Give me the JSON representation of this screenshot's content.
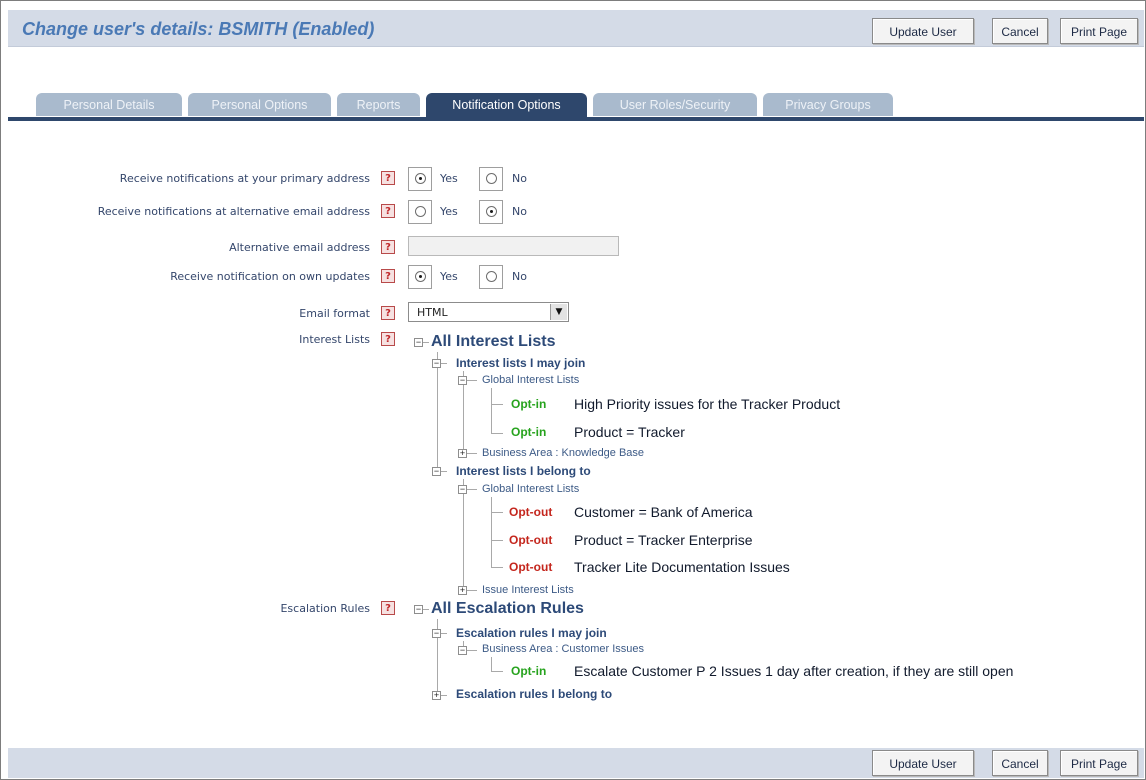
{
  "header": {
    "title": "Change user's details: BSMITH (Enabled)",
    "buttons": {
      "update": "Update User",
      "cancel": "Cancel",
      "print": "Print Page"
    }
  },
  "tabs": [
    {
      "label": "Personal Details",
      "active": false
    },
    {
      "label": "Personal Options",
      "active": false
    },
    {
      "label": "Reports",
      "active": false
    },
    {
      "label": "Notification Options",
      "active": true
    },
    {
      "label": "User Roles/Security",
      "active": false
    },
    {
      "label": "Privacy Groups",
      "active": false
    }
  ],
  "form": {
    "help_glyph": "?",
    "primary_address": {
      "label": "Receive notifications at your primary address",
      "yes": "Yes",
      "no": "No",
      "selected": "Yes"
    },
    "alternative_email": {
      "label": "Receive notifications at alternative email address",
      "yes": "Yes",
      "no": "No",
      "selected": "No"
    },
    "alt_email_address": {
      "label": "Alternative email address",
      "value": ""
    },
    "own_updates": {
      "label": "Receive notification on own updates",
      "yes": "Yes",
      "no": "No",
      "selected": "Yes"
    },
    "email_format": {
      "label": "Email format",
      "value": "HTML"
    },
    "interest_lists": {
      "label": "Interest Lists"
    },
    "escalation_rules": {
      "label": "Escalation Rules"
    }
  },
  "interest_tree": {
    "root": "All Interest Lists",
    "may_join": {
      "label": "Interest lists I may join",
      "global": {
        "label": "Global Interest Lists",
        "items": [
          {
            "action": "Opt-in",
            "text": "High Priority issues for the Tracker Product"
          },
          {
            "action": "Opt-in",
            "text": "Product = Tracker"
          }
        ]
      },
      "business_area": "Business Area : Knowledge Base"
    },
    "belong_to": {
      "label": "Interest lists I belong to",
      "global": {
        "label": "Global Interest Lists",
        "items": [
          {
            "action": "Opt-out",
            "text": "Customer = Bank of America"
          },
          {
            "action": "Opt-out",
            "text": "Product = Tracker Enterprise"
          },
          {
            "action": "Opt-out",
            "text": "Tracker Lite Documentation Issues"
          }
        ]
      },
      "issue_lists": "Issue Interest Lists"
    }
  },
  "escalation_tree": {
    "root": "All Escalation Rules",
    "may_join": {
      "label": "Escalation rules I may join",
      "business_area": {
        "label": "Business Area : Customer Issues",
        "items": [
          {
            "action": "Opt-in",
            "text": "Escalate Customer P 2 Issues 1 day after creation, if they are still open"
          }
        ]
      }
    },
    "belong_to": {
      "label": "Escalation rules I belong to"
    }
  },
  "footer": {
    "buttons": {
      "update": "Update User",
      "cancel": "Cancel",
      "print": "Print Page"
    }
  },
  "colors": {
    "header_bar": "#d4dbe7",
    "title": "#4a79b5",
    "active_tab": "#2e476c",
    "inactive_tab": "#a9bacd",
    "opt_in": "#27a31e",
    "opt_out": "#c4261d",
    "help_icon": "#c0282b"
  }
}
